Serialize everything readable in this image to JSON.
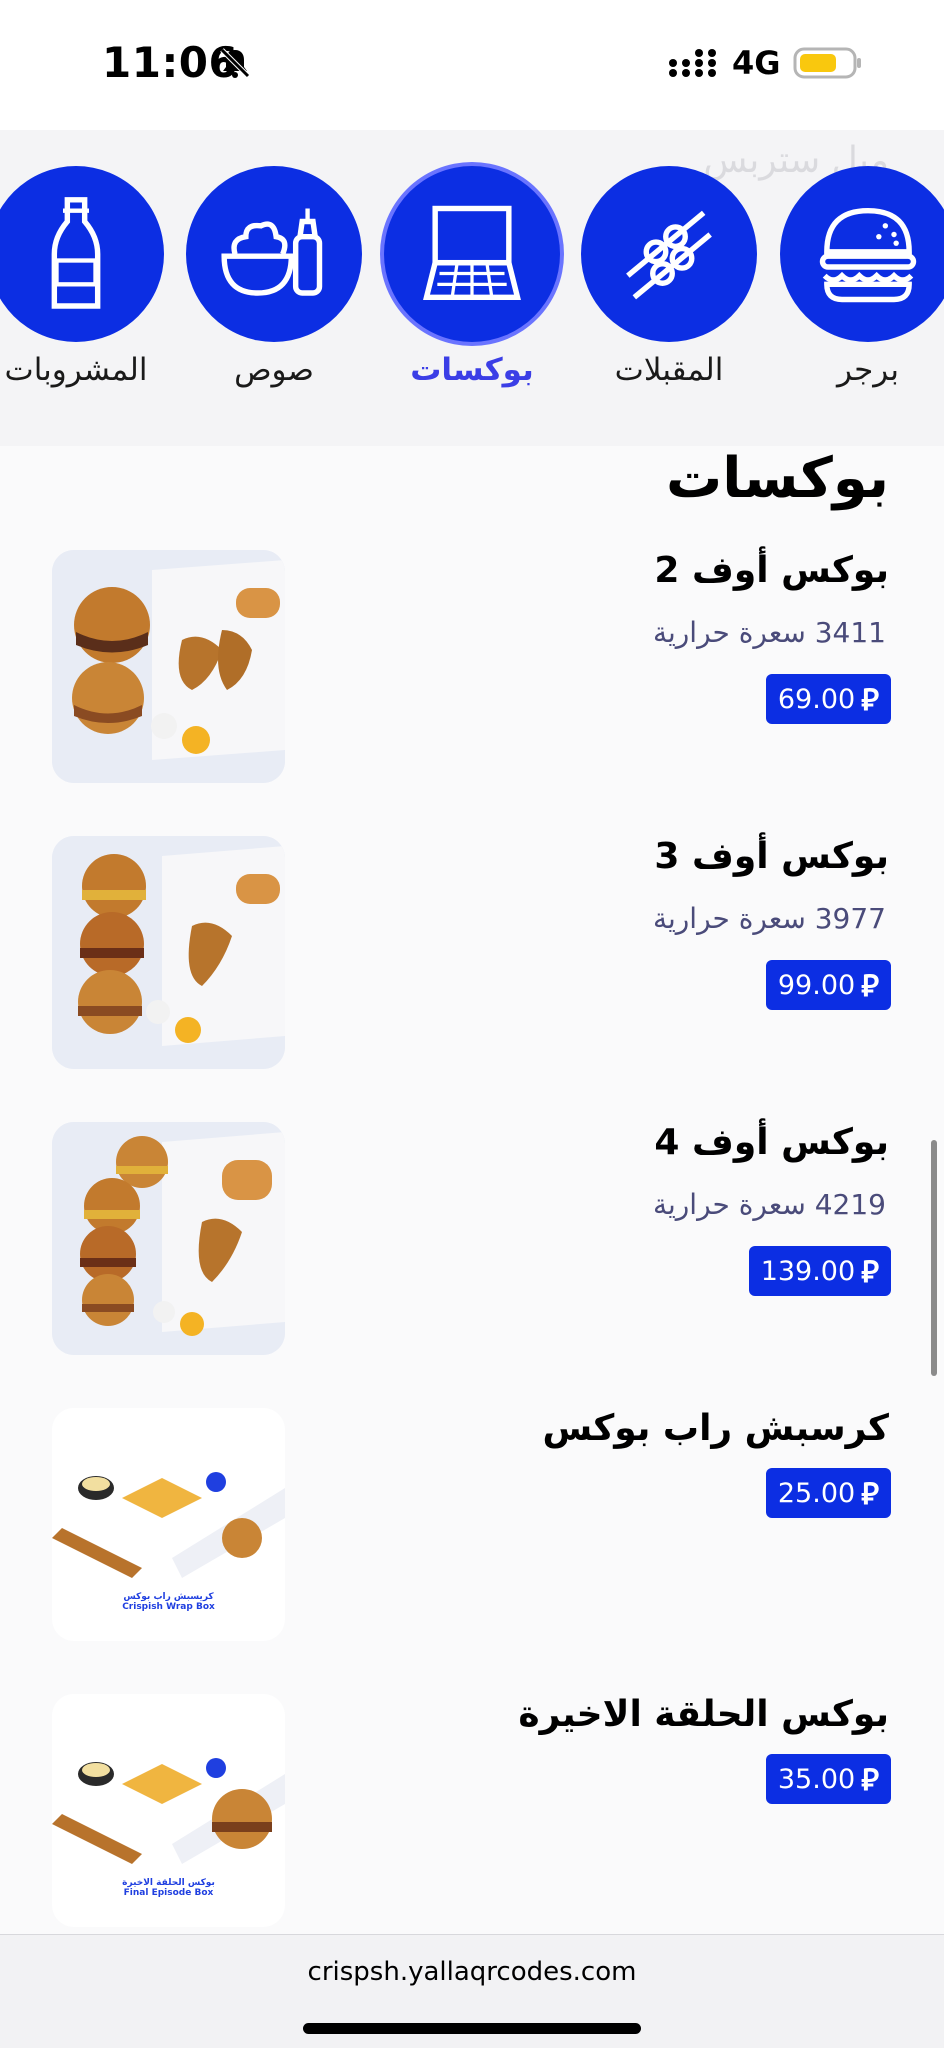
{
  "status_bar": {
    "time": "11:06",
    "network": "4G",
    "battery_color": "#f9c80e"
  },
  "categories": [
    {
      "label": "برجر",
      "icon": "burger-icon",
      "active": false
    },
    {
      "label": "المقبلات",
      "icon": "skewers-icon",
      "active": false
    },
    {
      "label": "بوكسات",
      "icon": "box-icon",
      "active": true
    },
    {
      "label": "صوص",
      "icon": "sauce-icon",
      "active": false
    },
    {
      "label": "المشروبات",
      "icon": "bottle-icon",
      "active": false
    }
  ],
  "ghost_text": "ميل ستربس",
  "section": {
    "title": "بوكسات"
  },
  "items": [
    {
      "name": "بوكس أوف 2",
      "calories": "3411 سعرة حرارية",
      "price": "69.00"
    },
    {
      "name": "بوكس أوف 3",
      "calories": "3977 سعرة حرارية",
      "price": "99.00"
    },
    {
      "name": "بوكس أوف 4",
      "calories": "4219 سعرة حرارية",
      "price": "139.00"
    },
    {
      "name": "كرسبش راب بوكس",
      "calories": "",
      "price": "25.00",
      "image_caption_ar": "كريسبش راب بوكس",
      "image_caption_en": "Crispish Wrap Box"
    },
    {
      "name": "بوكس الحلقة الاخيرة",
      "calories": "",
      "price": "35.00",
      "image_caption_ar": "بوكس الحلقة الاخيرة",
      "image_caption_en": "Final Episode Box"
    }
  ],
  "currency_symbol": "⃁",
  "footer": {
    "url": "crispsh.yallaqrcodes.com"
  },
  "colors": {
    "brand_blue": "#0c2ee3",
    "active_label": "#3b3ee6",
    "calorie_text": "#4a4b7a"
  }
}
